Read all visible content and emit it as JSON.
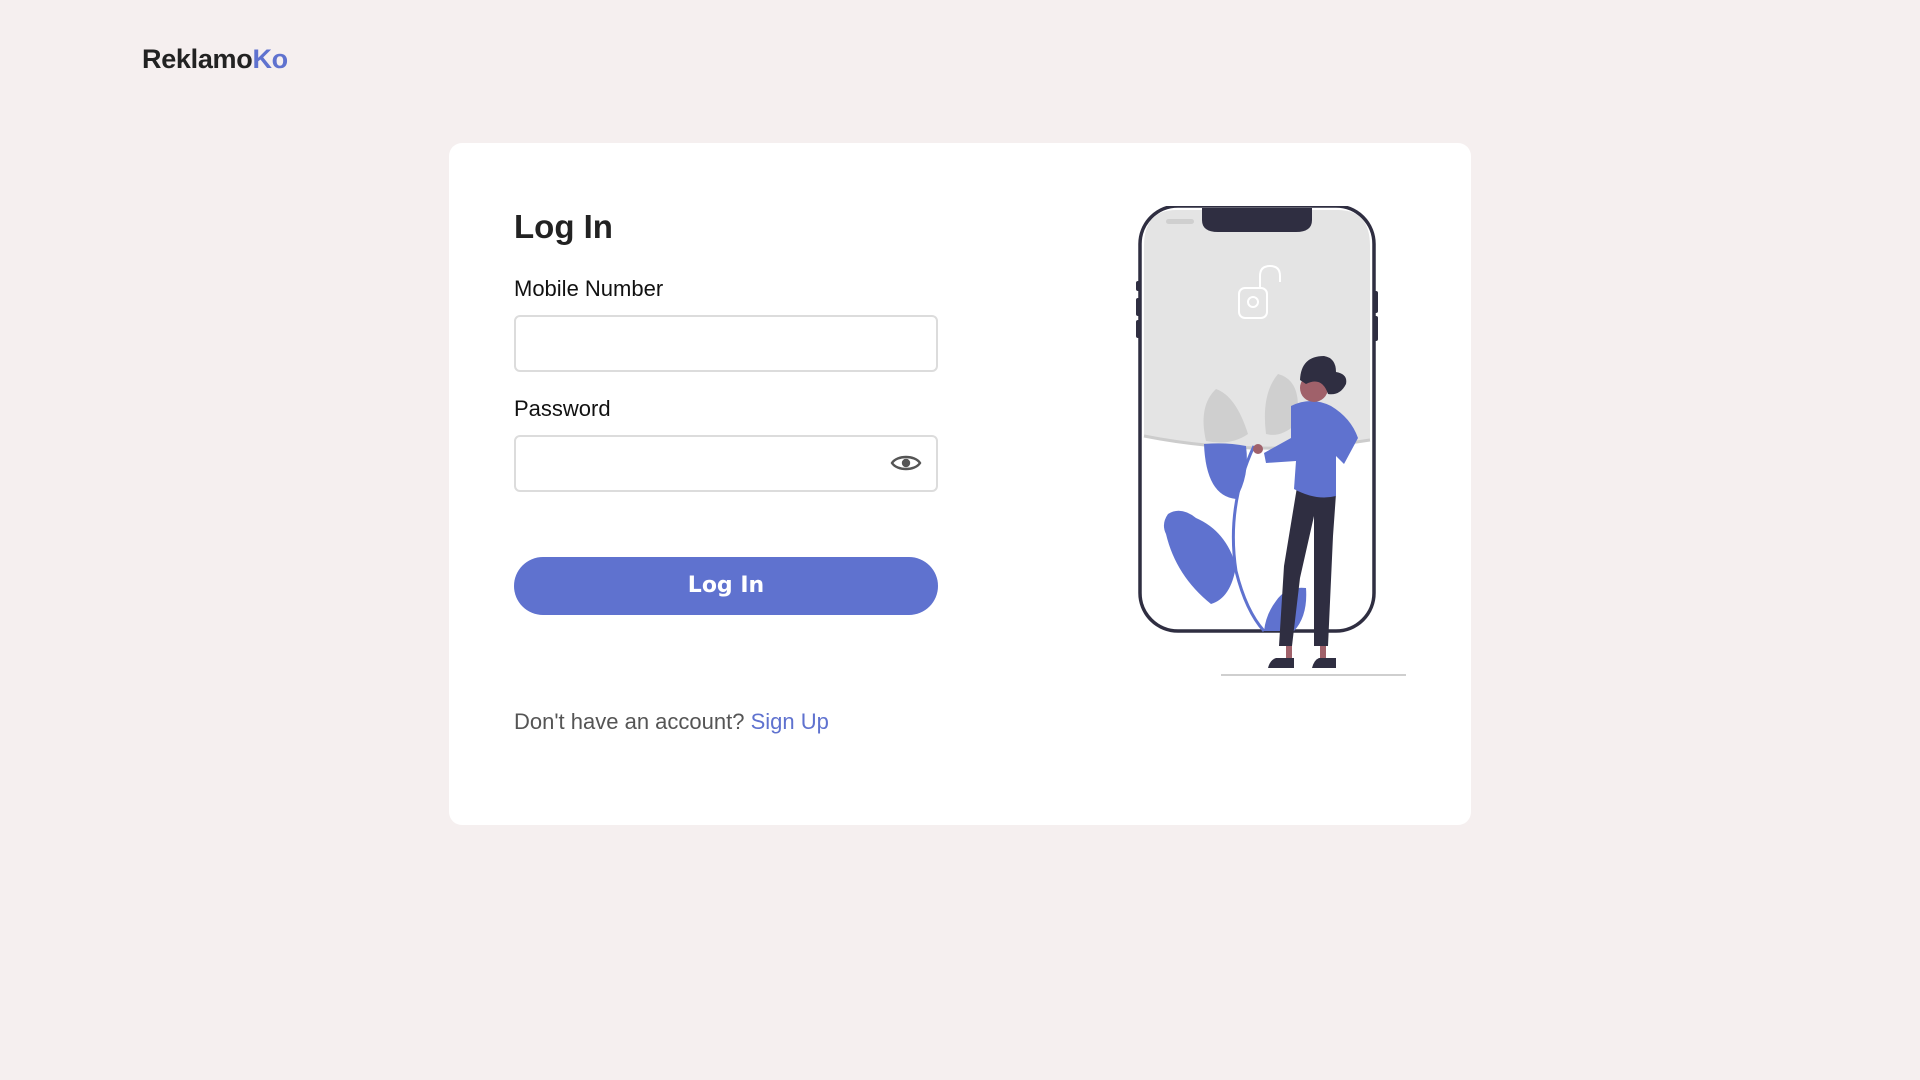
{
  "brand": {
    "name_main": "Reklamo",
    "name_accent": "Ko",
    "accent_color": "#5f72cf"
  },
  "login": {
    "title": "Log In",
    "mobile_label": "Mobile Number",
    "mobile_value": "",
    "mobile_placeholder": "",
    "password_label": "Password",
    "password_value": "",
    "password_placeholder": "",
    "toggle_icon": "eye-icon",
    "submit_label": "Log In",
    "signup_prompt": "Don't have an account?",
    "signup_link": "Sign Up"
  },
  "illustration": {
    "subject": "woman-with-phone-unlock-illustration",
    "icon": "unlock-icon"
  },
  "colors": {
    "background": "#f5efef",
    "card": "#ffffff",
    "primary": "#5f72cf",
    "dark": "#2f2e41"
  }
}
